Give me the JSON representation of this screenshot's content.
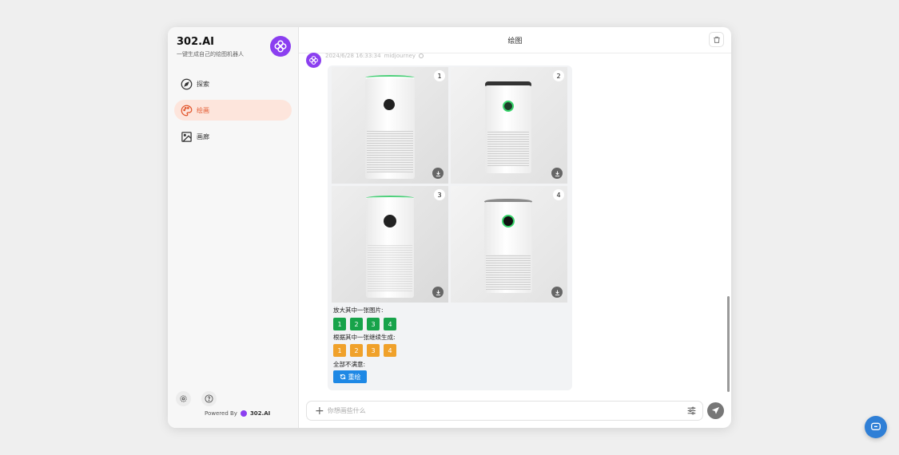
{
  "sidebar": {
    "brand_title": "302.AI",
    "brand_subtitle": "一键生成自己的绘图机器人",
    "items": [
      {
        "label": "探索",
        "icon": "compass-icon",
        "active": false
      },
      {
        "label": "绘画",
        "icon": "palette-icon",
        "active": true
      },
      {
        "label": "画廊",
        "icon": "image-icon",
        "active": false
      }
    ],
    "bottom_icons": [
      "settings-icon",
      "help-icon"
    ],
    "powered_by": "Powered By",
    "powered_brand": "302.AI"
  },
  "header": {
    "title": "绘图",
    "trash_icon": "trash-icon"
  },
  "message": {
    "timestamp": "2024/6/28 16:33:34",
    "model": "midjourney",
    "images": [
      {
        "number": "1"
      },
      {
        "number": "2"
      },
      {
        "number": "3"
      },
      {
        "number": "4"
      }
    ],
    "upscale_label": "放大其中一张图片:",
    "upscale_buttons": [
      "1",
      "2",
      "3",
      "4"
    ],
    "variation_label": "根据其中一张继续生成:",
    "variation_buttons": [
      "1",
      "2",
      "3",
      "4"
    ],
    "unsatisfied_label": "全部不满意:",
    "redraw_label": "重绘"
  },
  "input": {
    "placeholder": "你想画些什么",
    "value": ""
  },
  "colors": {
    "accent": "#e2562c",
    "brand": "#8b3ff0",
    "upscale_btn": "#17a34a",
    "variation_btn": "#f0a12a",
    "redraw_btn": "#1e88e5"
  }
}
